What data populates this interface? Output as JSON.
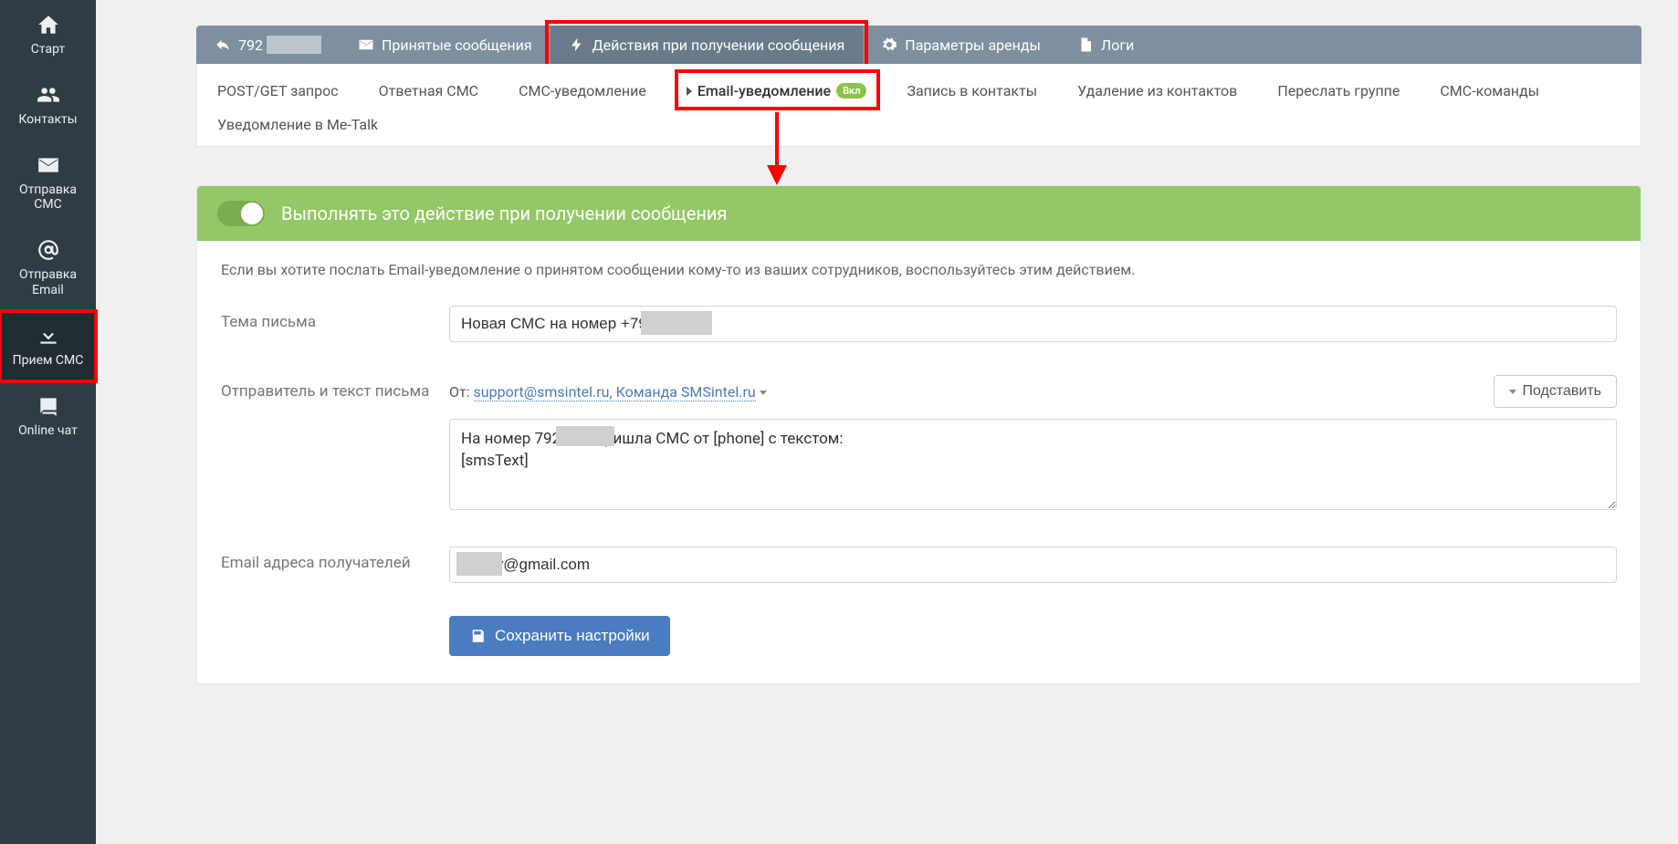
{
  "sidebar": {
    "items": [
      {
        "label": "Старт",
        "icon": "home-icon"
      },
      {
        "label": "Контакты",
        "icon": "users-icon"
      },
      {
        "label": "Отправка СМС",
        "icon": "envelope-icon"
      },
      {
        "label": "Отправка Email",
        "icon": "at-icon"
      },
      {
        "label": "Прием СМС",
        "icon": "download-icon",
        "active": true,
        "highlight": true
      },
      {
        "label": "Online чат",
        "icon": "chat-icon"
      }
    ]
  },
  "topnav": {
    "phone_prefix": "792",
    "items": [
      {
        "label": "Принятые сообщения",
        "icon": "envelope-icon"
      },
      {
        "label": "Действия при получении сообщения",
        "icon": "bolt-icon",
        "active": true,
        "highlight": true
      },
      {
        "label": "Параметры аренды",
        "icon": "gear-icon"
      },
      {
        "label": "Логи",
        "icon": "file-icon"
      }
    ]
  },
  "subnav": {
    "row1": [
      {
        "label": "POST/GET запрос"
      },
      {
        "label": "Ответная СМС"
      },
      {
        "label": "СМС-уведомление"
      },
      {
        "label": "Email-уведомление",
        "current": true,
        "badge": "Вкл",
        "highlight": true
      },
      {
        "label": "Запись в контакты"
      },
      {
        "label": "Удаление из контактов"
      },
      {
        "label": "Переслать группе"
      }
    ],
    "row2": [
      {
        "label": "СМС-команды"
      },
      {
        "label": "Уведомление в Me-Talk"
      }
    ]
  },
  "panel": {
    "toggle_label": "Выполнять это действие при получении сообщения",
    "description": "Если вы хотите послать Email-уведомление о принятом сообщении кому-то из ваших сотрудников, воспользуйтесь этим действием.",
    "subject_label": "Тема письма",
    "subject_value": "Новая СМС на номер +792",
    "sender_label": "Отправитель и текст письма",
    "sender_from_prefix": "От: ",
    "sender_from_link": "support@smsintel.ru, Команда SMSintel.ru",
    "insert_btn": "Подставить",
    "body_value_prefix": "На номер 792",
    "body_value_suffix": " пришла СМС от [phone] с текстом:\n[smsText]",
    "recipients_label": "Email адреса получателей",
    "recipients_value_suffix": "ov@gmail.com",
    "save_btn": "Сохранить настройки"
  }
}
